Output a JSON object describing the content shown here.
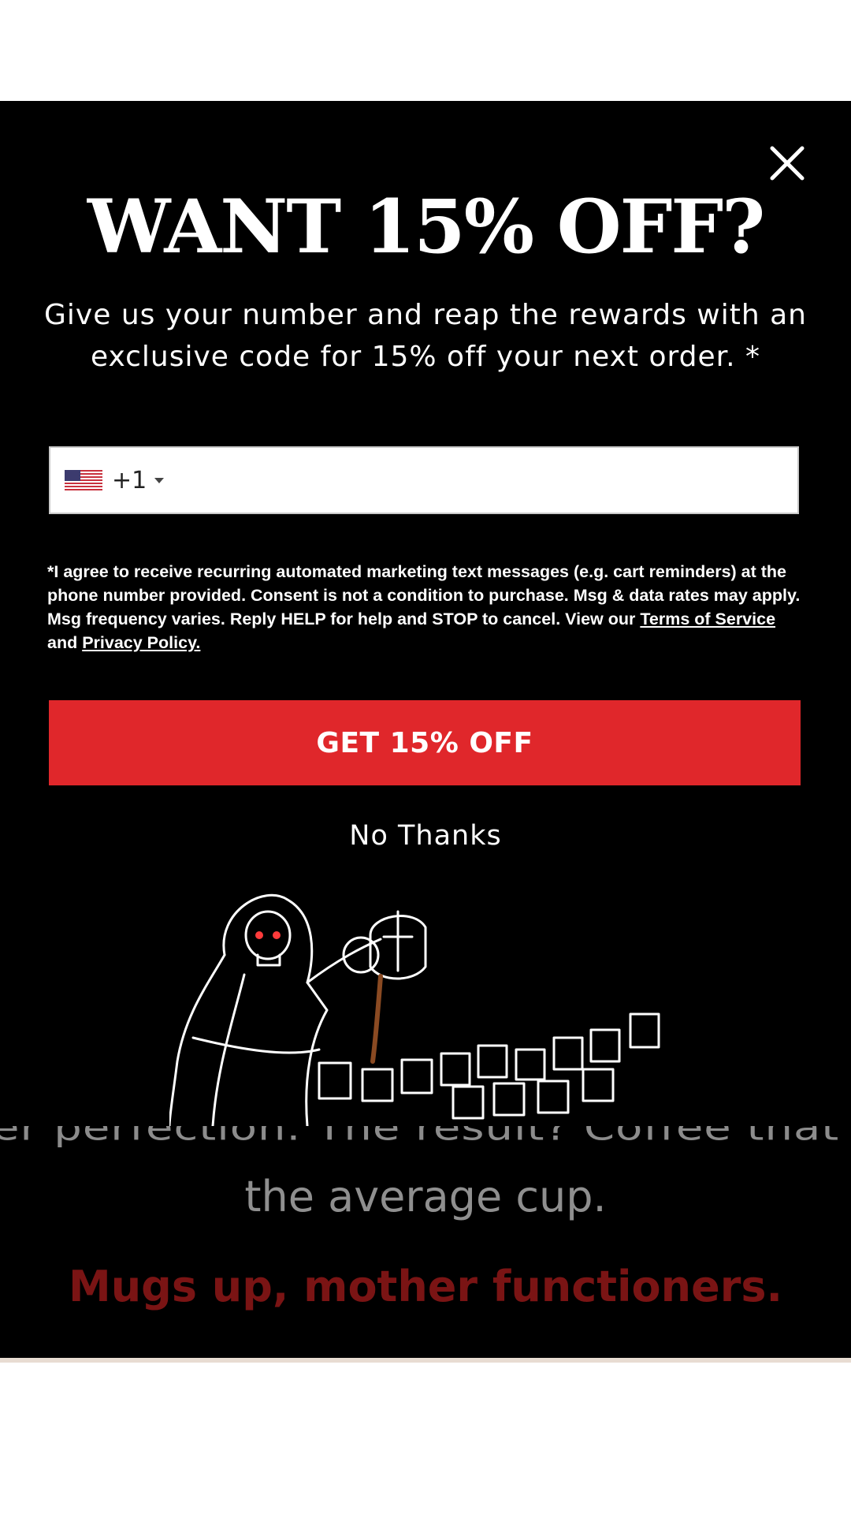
{
  "popup": {
    "title": "WANT 15% OFF?",
    "subtitle": "Give us your number and reap the rewards with an exclusive code for 15% off your next order.",
    "subtitle_asterisk": "*",
    "phone": {
      "dial_code": "+1",
      "value": "",
      "country_flag": "us-flag-icon"
    },
    "consent": {
      "prefix": "*",
      "text": "I agree to receive recurring automated marketing text messages (e.g. cart reminders) at the phone number provided. Consent is not a condition to purchase. Msg & data rates may apply. Msg frequency varies. Reply HELP for help and STOP to cancel. View our ",
      "terms_link": "Terms of Service ",
      "conjunction": "and ",
      "privacy_link": "Privacy Policy."
    },
    "cta_label": "GET 15% OFF",
    "decline_label": "No Thanks",
    "illustration": "grim-reaper-pouring-coffee-icon"
  },
  "background": {
    "partial_line": "er perfection. The result? Coffee that h",
    "line": "the average cup.",
    "tagline": "Mugs up, mother functioners."
  },
  "colors": {
    "accent": "#e0272b",
    "tagline": "#7a1414",
    "popup_bg": "#000000"
  }
}
